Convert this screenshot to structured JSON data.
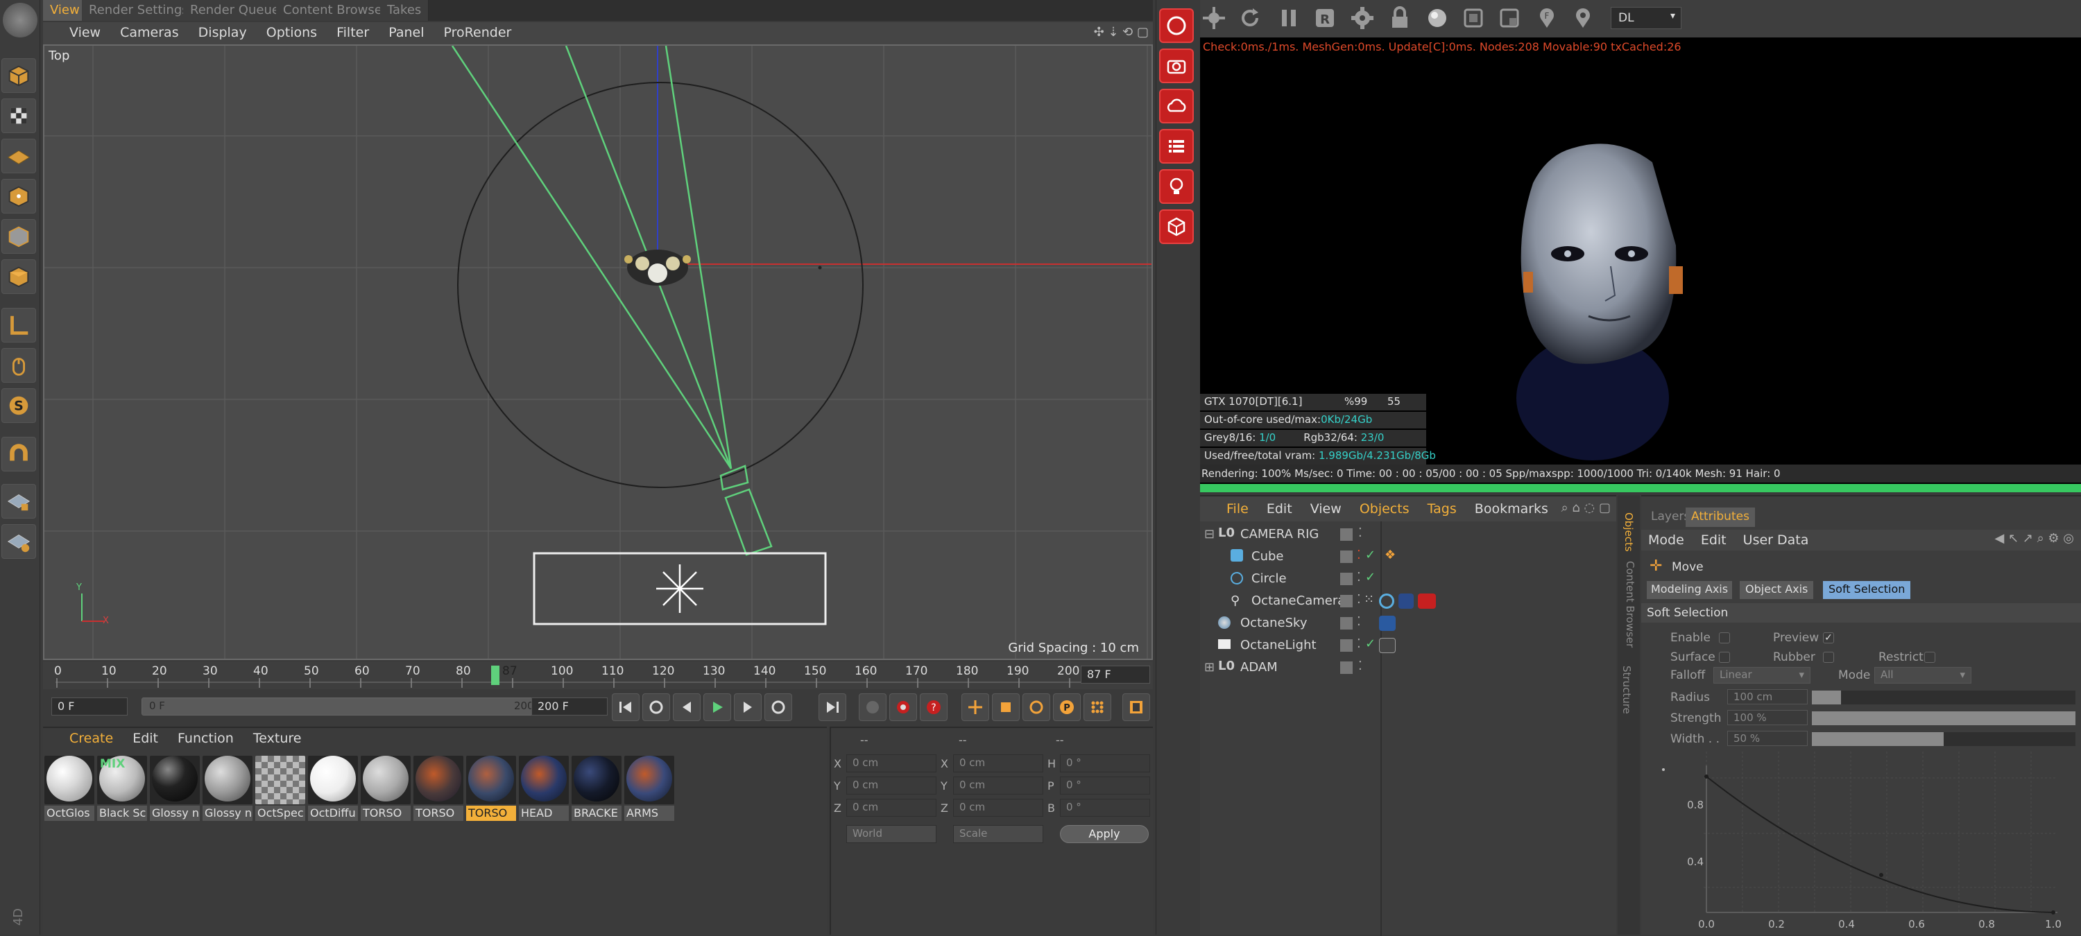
{
  "top_tabs": [
    "View",
    "Render Settings",
    "Render Queue",
    "Content Browser",
    "Takes"
  ],
  "viewport": {
    "menu": [
      "View",
      "Cameras",
      "Display",
      "Options",
      "Filter",
      "Panel",
      "ProRender"
    ],
    "view_name": "Top",
    "grid_spacing": "Grid Spacing : 10 cm",
    "axis_y": "Y",
    "axis_x": "X"
  },
  "timeline": {
    "ticks": [
      "0",
      "10",
      "20",
      "30",
      "40",
      "50",
      "60",
      "70",
      "80",
      "87",
      "100",
      "110",
      "120",
      "130",
      "140",
      "150",
      "160",
      "170",
      "180",
      "190",
      "200"
    ],
    "current_frame": "87 F",
    "start_field": "0 F",
    "range_start": "0 F",
    "range_end": "200 F",
    "end_field": "200 F"
  },
  "material_manager": {
    "menu": [
      "Create",
      "Edit",
      "Function",
      "Texture"
    ],
    "materials": [
      {
        "label": "OctGlos",
        "selected": false
      },
      {
        "label": "Black Sc",
        "selected": false,
        "badge": "MIX"
      },
      {
        "label": "Glossy n",
        "selected": false
      },
      {
        "label": "Glossy n",
        "selected": false
      },
      {
        "label": "OctSpec",
        "selected": false
      },
      {
        "label": "OctDiffu",
        "selected": false
      },
      {
        "label": "TORSO",
        "selected": false
      },
      {
        "label": "TORSO",
        "selected": false
      },
      {
        "label": "TORSO",
        "selected": true
      },
      {
        "label": "HEAD",
        "selected": false
      },
      {
        "label": "BRACKE",
        "selected": false
      },
      {
        "label": "ARMS",
        "selected": false
      }
    ]
  },
  "coordinates": {
    "headers": [
      "--",
      "--",
      "--"
    ],
    "rows": [
      {
        "a": "X",
        "av": "0 cm",
        "b": "X",
        "bv": "0 cm",
        "c": "H",
        "cv": "0 °"
      },
      {
        "a": "Y",
        "av": "0 cm",
        "b": "Y",
        "bv": "0 cm",
        "c": "P",
        "cv": "0 °"
      },
      {
        "a": "Z",
        "av": "0 cm",
        "b": "Z",
        "bv": "0 cm",
        "c": "B",
        "cv": "0 °"
      }
    ],
    "world": "World",
    "scale": "Scale",
    "apply": "Apply"
  },
  "octane": {
    "renderer_select": "DL",
    "status_line": "Check:0ms./1ms. MeshGen:0ms. Update[C]:0ms. Nodes:208 Movable:90 txCached:26",
    "gpu": "GTX 1070[DT][6.1]",
    "gpu_pct": "%99",
    "gpu_temp": "55",
    "out_of_core_label": "Out-of-core used/max:",
    "out_of_core_value": "0Kb/24Gb",
    "grey_label": "Grey8/16: ",
    "grey_value": "1/0",
    "rgb_label": "Rgb32/64: ",
    "rgb_value": "23/0",
    "vram_label": "Used/free/total vram: ",
    "vram_value": "1.989Gb/4.231Gb/8Gb",
    "render_line": "Rendering: 100%  Ms/sec: 0    Time: 00 : 00 : 05/00 : 00 : 05  Spp/maxspp: 1000/1000   Tri: 0/140k   Mesh: 91    Hair: 0",
    "progress": 1.0
  },
  "object_manager": {
    "menu": [
      "File",
      "Edit",
      "View",
      "Objects",
      "Tags",
      "Bookmarks"
    ],
    "objects": [
      {
        "name": "CAMERA RIG",
        "indent": 0
      },
      {
        "name": "Cube",
        "indent": 1
      },
      {
        "name": "Circle",
        "indent": 1
      },
      {
        "name": "OctaneCamera",
        "indent": 1
      },
      {
        "name": "OctaneSky",
        "indent": 0
      },
      {
        "name": "OctaneLight",
        "indent": 0
      },
      {
        "name": "ADAM",
        "indent": 0
      }
    ],
    "side_tabs": [
      "Objects",
      "Content Browser",
      "Structure"
    ]
  },
  "attributes": {
    "tabs": [
      "Layers",
      "Attributes"
    ],
    "menu": [
      "Mode",
      "Edit",
      "User Data"
    ],
    "tool": "Move",
    "subtabs": [
      "Modeling Axis",
      "Object Axis",
      "Soft Selection"
    ],
    "section": "Soft Selection",
    "enable": "Enable",
    "preview": "Preview",
    "surface": "Surface",
    "rubber": "Rubber",
    "restrict": "Restrict",
    "falloff_label": "Falloff",
    "falloff_value": "Linear",
    "mode_label": "Mode",
    "mode_value": "All",
    "radius_label": "Radius",
    "radius_value": "100 cm",
    "strength_label": "Strength",
    "strength_value": "100 %",
    "width_label": "Width . .",
    "width_value": "50 %",
    "graph_y": [
      "0.8",
      "0.4"
    ],
    "graph_x": [
      "0.0",
      "0.2",
      "0.4",
      "0.6",
      "0.8",
      "1.0"
    ]
  },
  "corner_label": "4D"
}
